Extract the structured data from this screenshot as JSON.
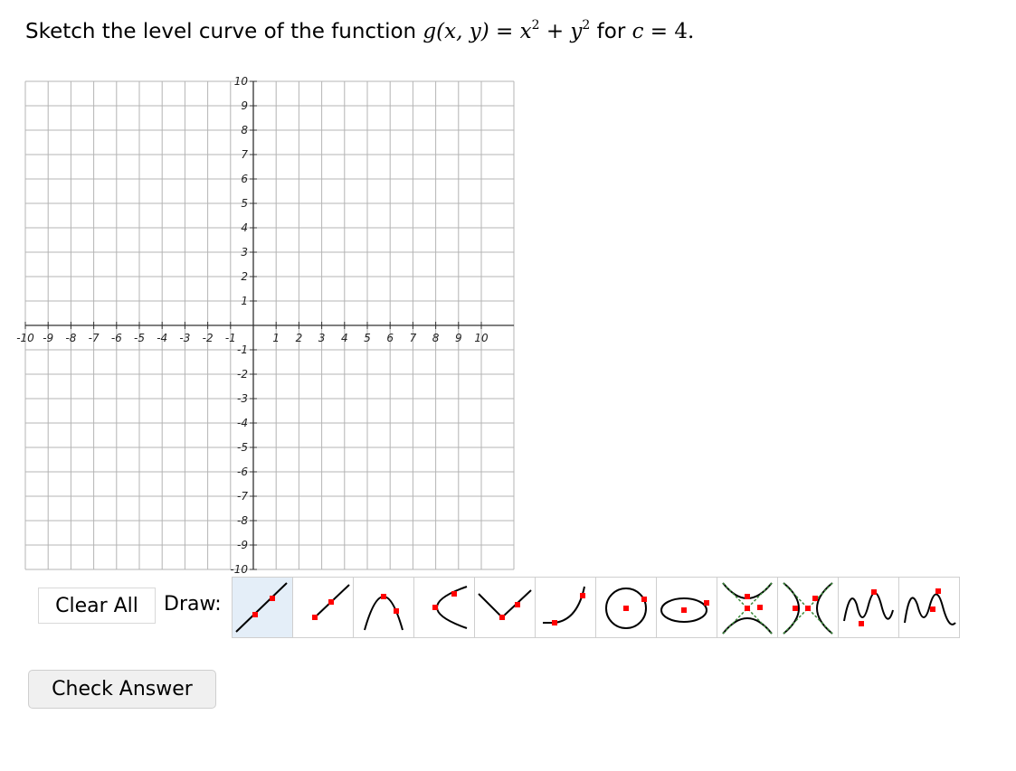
{
  "question": {
    "lead": "Sketch the level curve of the function ",
    "fn_name": "g",
    "fn_args": "(x, y)",
    "eq": " = ",
    "expr_x": "x",
    "exp_x": "2",
    "plus": " + ",
    "expr_y": "y",
    "exp_y": "2",
    "for_text": " for ",
    "c_var": "c",
    "c_eq": " = 4."
  },
  "graph": {
    "x_ticks": [
      "-10",
      "-9",
      "-8",
      "-7",
      "-6",
      "-5",
      "-4",
      "-3",
      "-2",
      "-1",
      "1",
      "2",
      "3",
      "4",
      "5",
      "6",
      "7",
      "8",
      "9",
      "10"
    ],
    "y_ticks": [
      "10",
      "9",
      "8",
      "7",
      "6",
      "5",
      "4",
      "3",
      "2",
      "1",
      "-1",
      "-2",
      "-3",
      "-4",
      "-5",
      "-6",
      "-7",
      "-8",
      "-9",
      "-10"
    ],
    "x_range": [
      -10,
      10
    ],
    "y_range": [
      -10,
      10
    ],
    "grid": true
  },
  "controls": {
    "clear_all": "Clear All",
    "draw_label": "Draw:",
    "check_answer": "Check Answer"
  },
  "tools": [
    {
      "name": "line-tool-icon",
      "selected": true
    },
    {
      "name": "ray-tool-icon",
      "selected": false
    },
    {
      "name": "parabola-tool-icon",
      "selected": false
    },
    {
      "name": "horizontal-parabola-tool-icon",
      "selected": false
    },
    {
      "name": "absolute-value-tool-icon",
      "selected": false
    },
    {
      "name": "square-root-tool-icon",
      "selected": false
    },
    {
      "name": "circle-tool-icon",
      "selected": false
    },
    {
      "name": "ellipse-tool-icon",
      "selected": false
    },
    {
      "name": "vertical-hyperbola-tool-icon",
      "selected": false
    },
    {
      "name": "horizontal-hyperbola-tool-icon",
      "selected": false
    },
    {
      "name": "sine-tool-icon",
      "selected": false
    },
    {
      "name": "cosine-tool-icon",
      "selected": false
    }
  ]
}
